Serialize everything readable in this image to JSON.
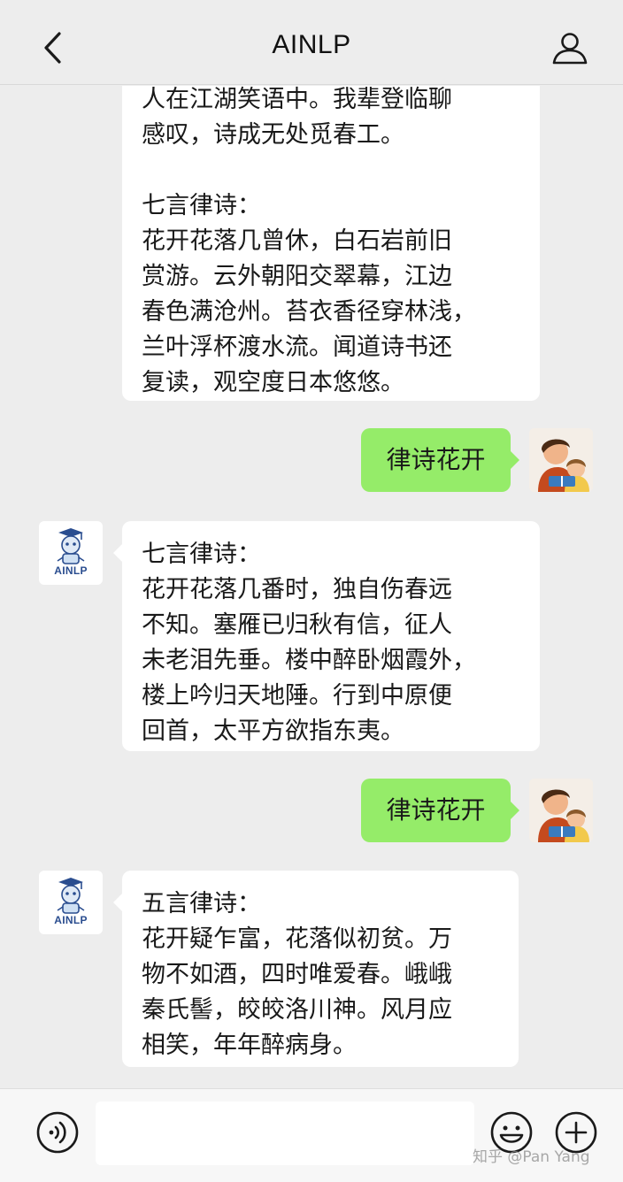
{
  "header": {
    "title": "AINLP",
    "back_icon": "chevron-left-icon",
    "profile_icon": "person-icon"
  },
  "messages": [
    {
      "sender": "bot",
      "text": "人在江湖笑语中。我辈登临聊\n感叹，诗成无处觅春工。\n\n七言律诗：\n花开花落几曾休，白石岩前旧\n赏游。云外朝阳交翠幕，江边\n春色满沧州。苔衣香径穿林浅，\n兰叶浮杯渡水流。闻道诗书还\n复读，观空度日本悠悠。"
    },
    {
      "sender": "user",
      "text": "律诗花开"
    },
    {
      "sender": "bot",
      "avatar_label": "AINLP",
      "text": "七言律诗：\n花开花落几番时，独自伤春远\n不知。塞雁已归秋有信，征人\n未老泪先垂。楼中醉卧烟霞外，\n楼上吟归天地陲。行到中原便\n回首，太平方欲指东夷。"
    },
    {
      "sender": "user",
      "text": "律诗花开"
    },
    {
      "sender": "bot",
      "avatar_label": "AINLP",
      "text": "五言律诗：\n花开疑乍富，花落似初贫。万\n物不如酒，四时唯爱春。峨峨\n秦氏髻，皎皎洛川神。风月应\n相笑，年年醉病身。"
    }
  ],
  "footer": {
    "input_value": "",
    "voice_icon": "voice-icon",
    "emoji_icon": "emoji-icon",
    "plus_icon": "plus-icon"
  },
  "watermark": "知乎 @Pan Yang",
  "colors": {
    "background": "#ededed",
    "user_bubble": "#95ec69",
    "bot_bubble": "#ffffff"
  }
}
